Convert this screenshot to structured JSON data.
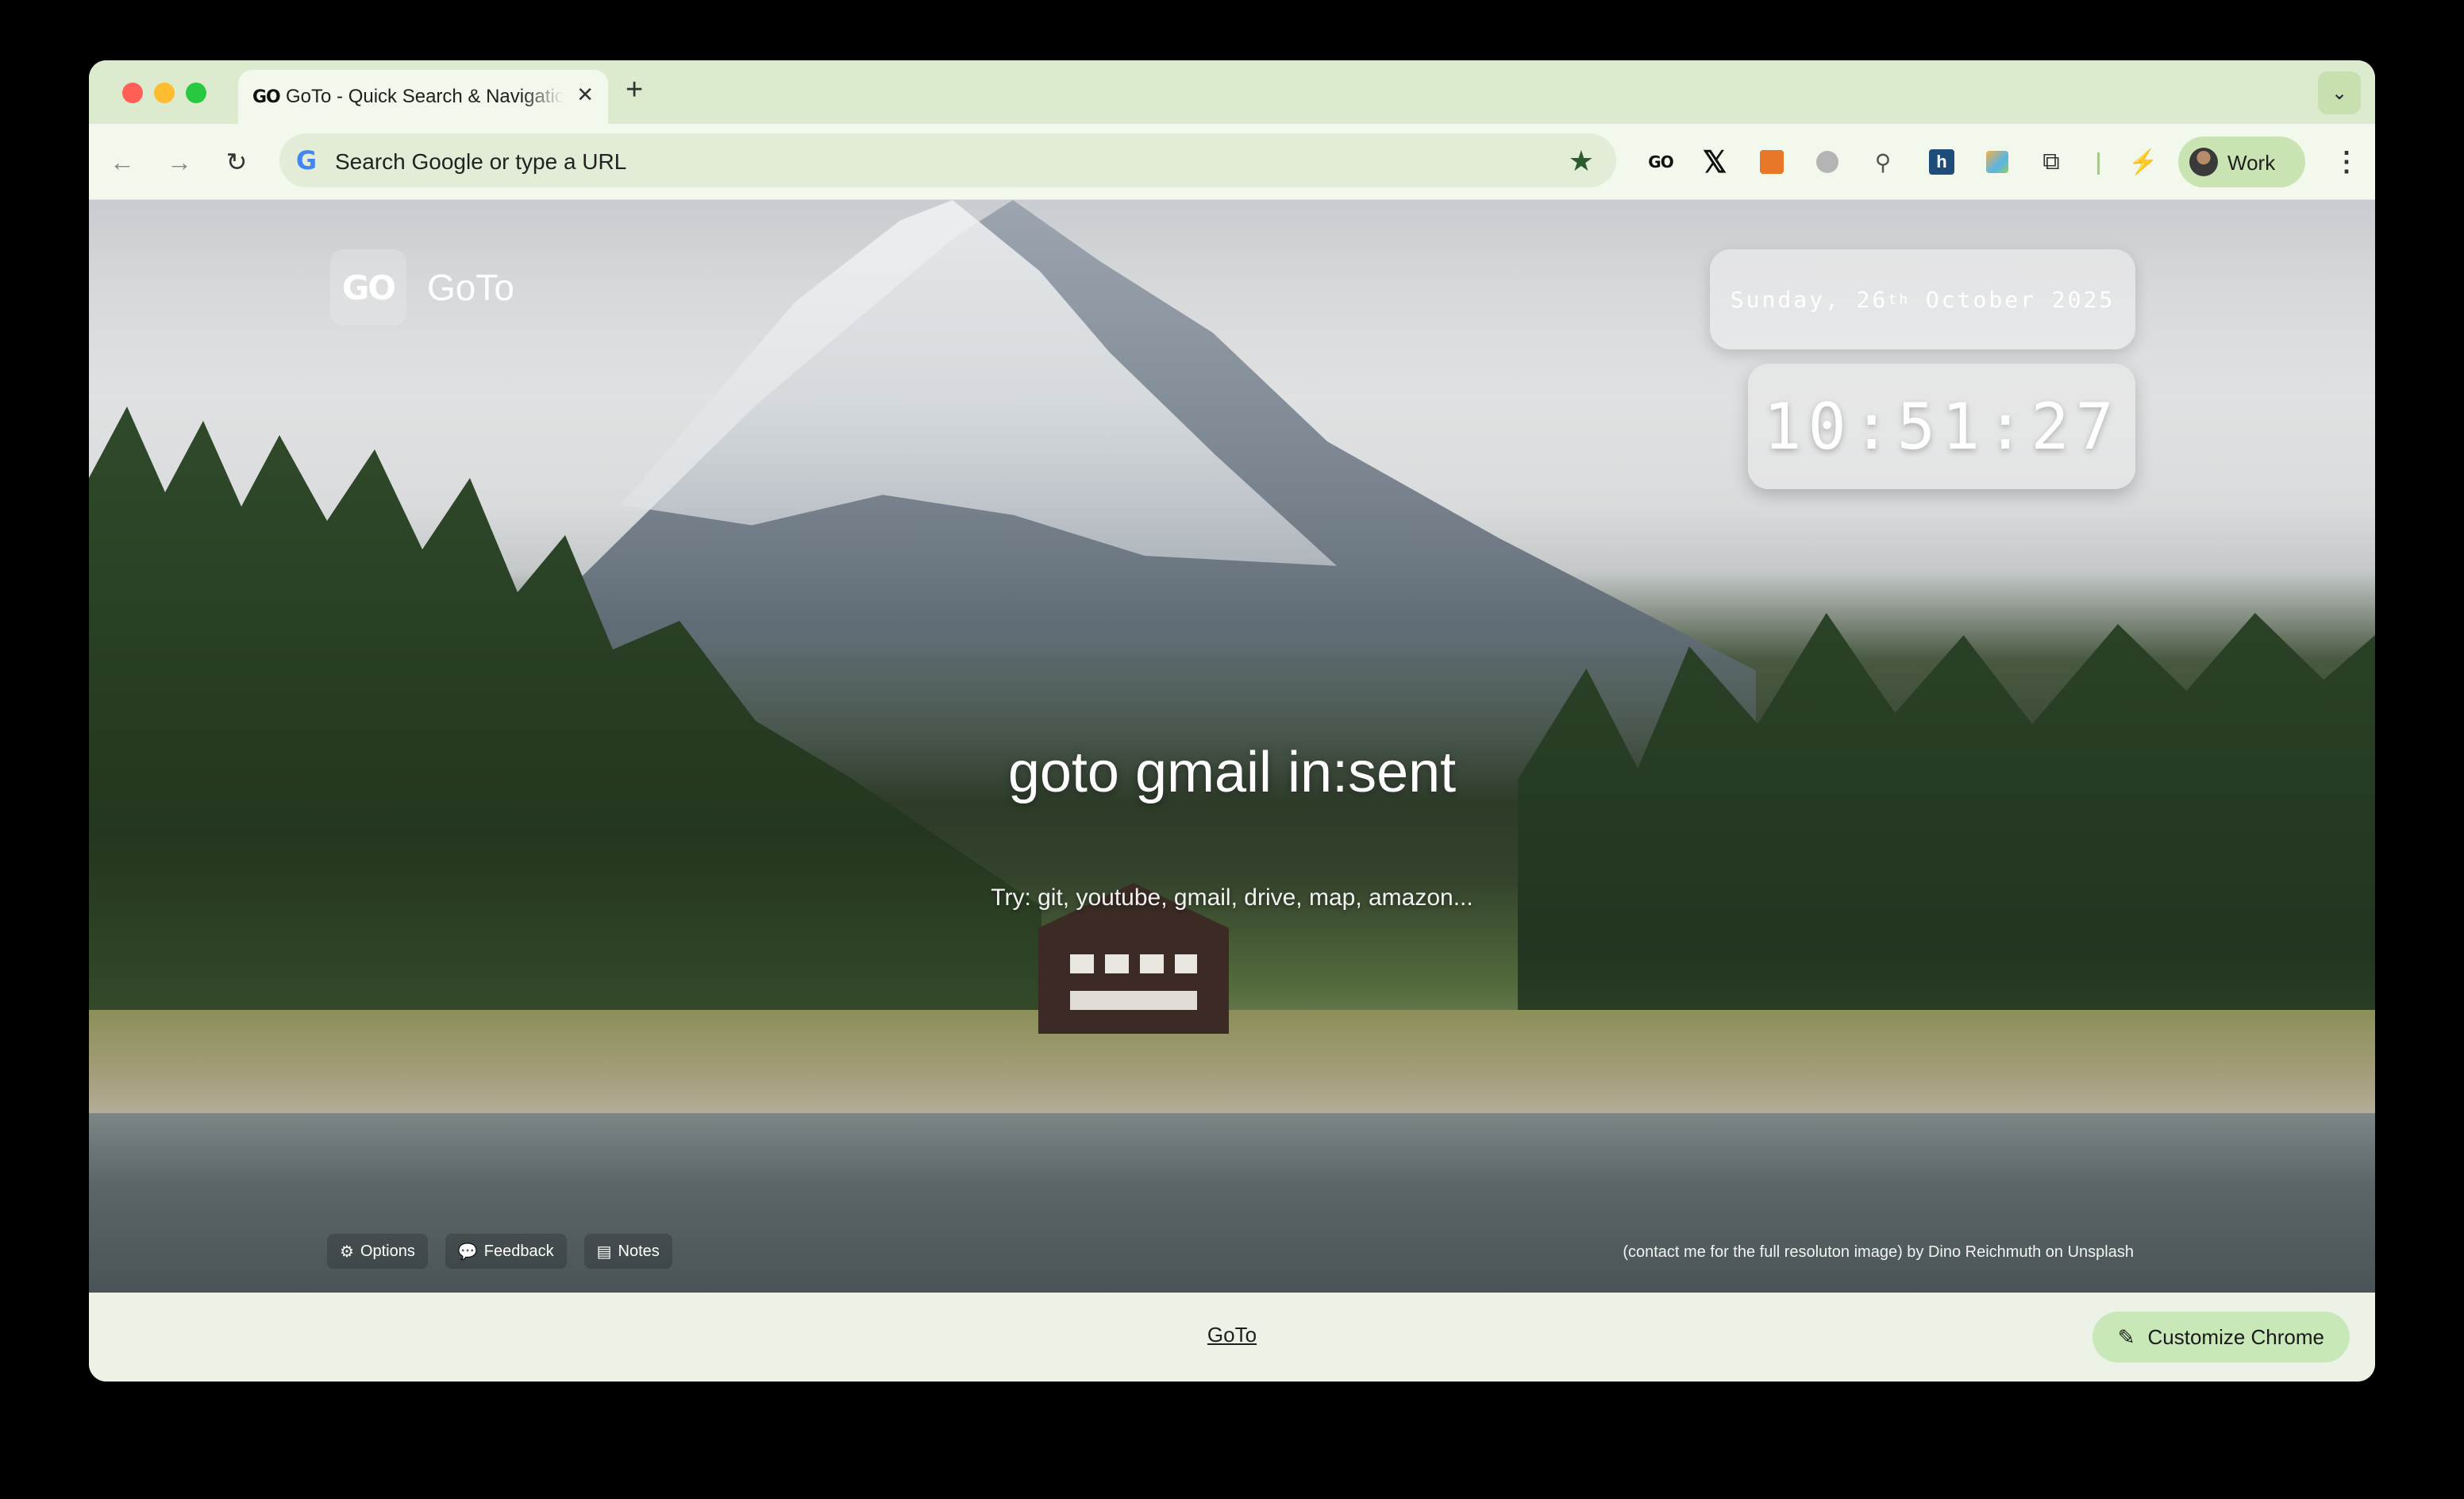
{
  "browser": {
    "tab": {
      "favicon": "GO",
      "title": "GoTo - Quick Search & Navigation",
      "close": "✕"
    },
    "new_tab": "+",
    "tab_search_icon": "chevron-down-icon",
    "omnibox": {
      "placeholder": "Search Google or type a URL",
      "google_logo": "G"
    },
    "extensions": [
      "goto-ext-icon",
      "x-icon",
      "orange-ext-icon",
      "grey-ext-icon",
      "telescope-icon",
      "blue-ext-icon",
      "image-ext-icon",
      "puzzle-icon",
      "performance-icon"
    ],
    "ext_go_label": "GO",
    "ext_blue_label": "h",
    "profile": {
      "name": "Work"
    }
  },
  "page": {
    "brand": {
      "logo": "GO",
      "name": "GoTo"
    },
    "date": {
      "weekday": "Sunday,",
      "day": "26",
      "suffix": "th",
      "month_year": "October 2025"
    },
    "clock": "10:51:27",
    "query": "goto gmail in:sent",
    "hint": "Try: git, youtube, gmail, drive, map, amazon...",
    "links": [
      {
        "icon": "⚙",
        "label": "Options"
      },
      {
        "icon": "💬",
        "label": "Feedback"
      },
      {
        "icon": "▤",
        "label": "Notes"
      }
    ],
    "credit": "(contact me for the full resoluton image) by Dino Reichmuth on Unsplash"
  },
  "footer": {
    "link": "GoTo",
    "customize_label": "Customize Chrome"
  },
  "colors": {
    "tabstrip": "#dcebcd",
    "toolbar": "#f3f8ec",
    "accent": "#c9e8b8"
  }
}
